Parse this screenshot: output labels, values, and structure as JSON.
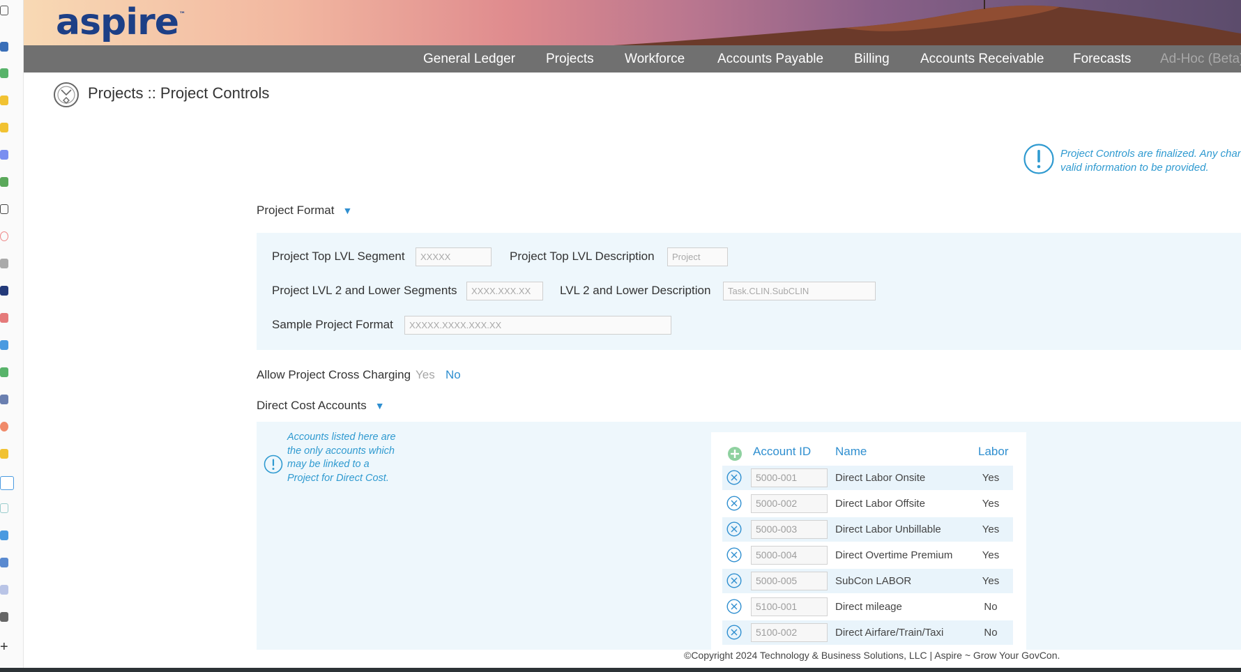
{
  "brand": {
    "logo_text": "aspire",
    "logo_tm": "™"
  },
  "nav": {
    "items": [
      {
        "label": "General Ledger"
      },
      {
        "label": "Projects"
      },
      {
        "label": "Workforce"
      },
      {
        "label": "Accounts Payable"
      },
      {
        "label": "Billing"
      },
      {
        "label": "Accounts Receivable"
      },
      {
        "label": "Forecasts"
      },
      {
        "label": "Ad-Hoc (Beta)"
      }
    ]
  },
  "page": {
    "title": "Projects :: Project Controls"
  },
  "notice": {
    "line1": "Project Controls are finalized. Any change",
    "line2": "valid information to be provided."
  },
  "project_format": {
    "header": "Project Format",
    "top_lvl_segment_label": "Project Top LVL Segment",
    "top_lvl_segment_value": "XXXXX",
    "top_lvl_description_label": "Project Top LVL Description",
    "top_lvl_description_value": "Project",
    "lvl2_segments_label": "Project LVL 2 and Lower Segments",
    "lvl2_segments_value": "XXXX.XXX.XX",
    "lvl2_description_label": "LVL 2 and Lower Description",
    "lvl2_description_value": "Task.CLIN.SubCLIN",
    "sample_label": "Sample Project Format",
    "sample_value": "XXXXX.XXXX.XXX.XX"
  },
  "cross_charging": {
    "label": "Allow Project Cross Charging",
    "yes": "Yes",
    "no": "No",
    "selected": "No"
  },
  "direct_cost": {
    "header": "Direct Cost Accounts",
    "info": "Accounts listed here are the only accounts which may be linked to a Project for Direct Cost.",
    "columns": {
      "account_id": "Account ID",
      "name": "Name",
      "labor": "Labor"
    },
    "rows": [
      {
        "account_id": "5000-001",
        "name": "Direct Labor Onsite",
        "labor": "Yes"
      },
      {
        "account_id": "5000-002",
        "name": "Direct Labor Offsite",
        "labor": "Yes"
      },
      {
        "account_id": "5000-003",
        "name": "Direct Labor Unbillable",
        "labor": "Yes"
      },
      {
        "account_id": "5000-004",
        "name": "Direct Overtime Premium",
        "labor": "Yes"
      },
      {
        "account_id": "5000-005",
        "name": "SubCon LABOR",
        "labor": "Yes"
      },
      {
        "account_id": "5100-001",
        "name": "Direct mileage",
        "labor": "No"
      },
      {
        "account_id": "5100-002",
        "name": "Direct Airfare/Train/Taxi",
        "labor": "No"
      }
    ]
  },
  "footer": {
    "text": "©Copyright 2024 Technology & Business Solutions, LLC  |  Aspire ~ Grow Your GovCon."
  },
  "colors": {
    "brand_blue": "#1d3f86",
    "accent_blue": "#2f8fd0",
    "nav_gray": "#707070",
    "panel_bg": "#eef7fc"
  }
}
